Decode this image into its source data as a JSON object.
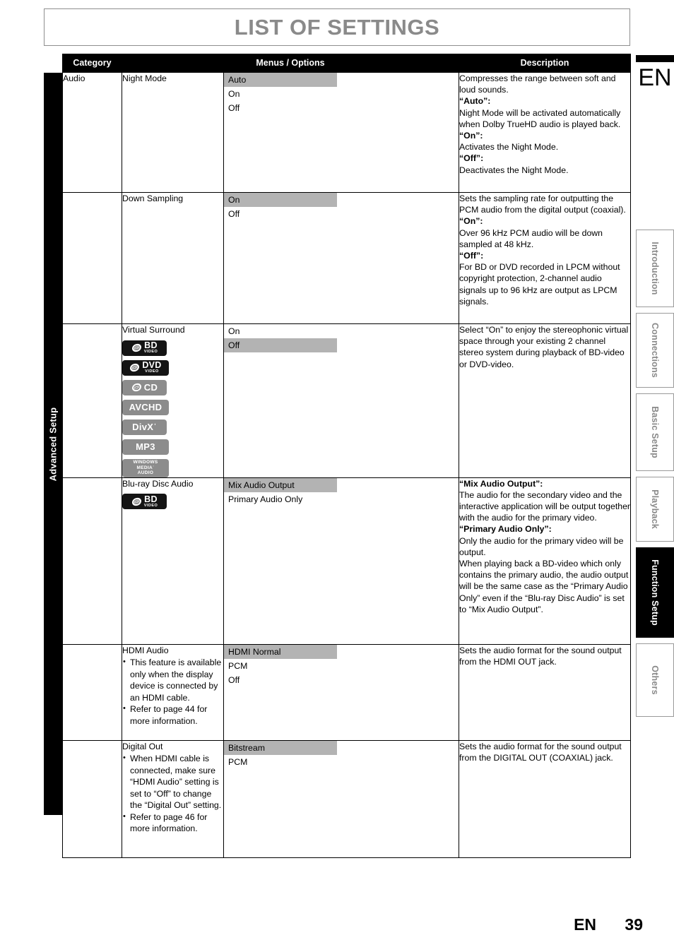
{
  "page": {
    "title": "LIST OF SETTINGS",
    "language_marker": "EN",
    "footer_language": "EN",
    "footer_page_number": "39",
    "left_tab_label": "Advanced Setup",
    "highlight_color": "#b3b3b3",
    "header_bg_color": "#000000",
    "title_color": "#8a8a8a"
  },
  "side_tabs": [
    {
      "label": "Introduction",
      "active": false
    },
    {
      "label": "Connections",
      "active": false
    },
    {
      "label": "Basic Setup",
      "active": false
    },
    {
      "label": "Playback",
      "active": false
    },
    {
      "label": "Function Setup",
      "active": true
    },
    {
      "label": "Others",
      "active": false
    }
  ],
  "table": {
    "headers": {
      "category": "Category",
      "menus": "Menus / Options",
      "description": "Description"
    },
    "rows": [
      {
        "category": "Audio",
        "menu": "Night Mode",
        "notes": [],
        "badges": [],
        "options": [
          {
            "label": "Auto",
            "highlighted": true
          },
          {
            "label": "On",
            "highlighted": false
          },
          {
            "label": "Off",
            "highlighted": false
          }
        ],
        "description": [
          {
            "text": "Compresses the range between soft and loud sounds.",
            "bold": false
          },
          {
            "text": "“Auto”:",
            "bold": true
          },
          {
            "text": "Night Mode will be activated automatically when Dolby TrueHD audio is played back.",
            "bold": false
          },
          {
            "text": "“On”:",
            "bold": true
          },
          {
            "text": "Activates the Night Mode.",
            "bold": false
          },
          {
            "text": "“Off”:",
            "bold": true
          },
          {
            "text": "Deactivates the Night Mode.",
            "bold": false
          }
        ]
      },
      {
        "category": "",
        "menu": "Down Sampling",
        "notes": [],
        "badges": [],
        "options": [
          {
            "label": "On",
            "highlighted": true
          },
          {
            "label": "Off",
            "highlighted": false
          }
        ],
        "description": [
          {
            "text": "Sets the sampling rate for outputting the PCM audio from the digital output (coaxial).",
            "bold": false
          },
          {
            "text": "“On”:",
            "bold": true
          },
          {
            "text": "Over 96 kHz PCM audio will be down sampled at 48 kHz.",
            "bold": false
          },
          {
            "text": "“Off”:",
            "bold": true
          },
          {
            "text": "For BD or DVD recorded in LPCM without copyright protection, 2-channel audio signals up to 96 kHz are output as LPCM signals.",
            "bold": false
          }
        ]
      },
      {
        "category": "",
        "menu": "Virtual Surround",
        "notes": [],
        "badges": [
          {
            "name": "bd-video-badge",
            "main": "BD",
            "sub": "VIDEO",
            "style": "dark",
            "disc": true,
            "width": "w63"
          },
          {
            "name": "dvd-video-badge",
            "main": "DVD",
            "sub": "VIDEO",
            "style": "dark",
            "disc": true,
            "width": "w66"
          },
          {
            "name": "cd-badge",
            "main": "CD",
            "sub": "",
            "style": "grey",
            "disc": true,
            "width": "w63"
          },
          {
            "name": "avchd-badge",
            "main": "AVCHD",
            "sub": "",
            "style": "grey",
            "disc": false,
            "width": "w66"
          },
          {
            "name": "divx-badge",
            "main": "DivXˈ",
            "sub": "",
            "style": "grey",
            "disc": false,
            "width": "w63"
          },
          {
            "name": "mp3-badge",
            "main": "MP3",
            "sub": "",
            "style": "grey",
            "disc": false,
            "width": "w66"
          },
          {
            "name": "windows-media-audio-badge",
            "main": "WINDOWS|MEDIAˈ|AUDIO",
            "sub": "",
            "style": "grey",
            "disc": false,
            "width": "wma"
          }
        ],
        "options": [
          {
            "label": "On",
            "highlighted": false
          },
          {
            "label": "Off",
            "highlighted": true
          }
        ],
        "description": [
          {
            "text": "Select “On” to enjoy the stereophonic virtual space through your existing 2 channel stereo system during playback of BD-video or DVD-video.",
            "bold": false
          }
        ]
      },
      {
        "category": "",
        "menu": "Blu-ray Disc Audio",
        "notes": [],
        "badges": [
          {
            "name": "bd-video-badge",
            "main": "BD",
            "sub": "VIDEO",
            "style": "dark",
            "disc": true,
            "width": "w63"
          }
        ],
        "options": [
          {
            "label": "Mix Audio Output",
            "highlighted": true
          },
          {
            "label": "Primary Audio Only",
            "highlighted": false
          }
        ],
        "description": [
          {
            "text": "“Mix Audio Output”:",
            "bold": true
          },
          {
            "text": "The audio for the secondary video and the interactive application will be output together with the audio for the primary video.",
            "bold": false
          },
          {
            "text": "“Primary Audio Only”:",
            "bold": true
          },
          {
            "text": "Only the audio for the primary video will be output.",
            "bold": false
          },
          {
            "text": "When playing back a BD-video which only contains the primary audio, the audio output will be the same case as the “Primary Audio Only” even if the “Blu-ray Disc Audio” is set to “Mix Audio Output”.",
            "bold": false
          }
        ]
      },
      {
        "category": "",
        "menu": "HDMI Audio",
        "notes": [
          "This feature is available only when the display device is connected by an HDMI cable.",
          "Refer to page 44 for more information."
        ],
        "badges": [],
        "options": [
          {
            "label": "HDMI Normal",
            "highlighted": true
          },
          {
            "label": "PCM",
            "highlighted": false
          },
          {
            "label": "Off",
            "highlighted": false
          }
        ],
        "description": [
          {
            "text": "Sets the audio format for the sound output from the HDMI OUT jack.",
            "bold": false
          }
        ]
      },
      {
        "category": "",
        "menu": "Digital Out",
        "notes": [
          "When HDMI cable is connected, make sure “HDMI Audio” setting is set to “Off” to change the “Digital Out” setting.",
          "Refer to page 46 for more information."
        ],
        "badges": [],
        "options": [
          {
            "label": "Bitstream",
            "highlighted": true
          },
          {
            "label": "PCM",
            "highlighted": false
          }
        ],
        "description": [
          {
            "text": "Sets the audio format for the sound output from the DIGITAL OUT (COAXIAL) jack.",
            "bold": false
          }
        ]
      }
    ]
  }
}
